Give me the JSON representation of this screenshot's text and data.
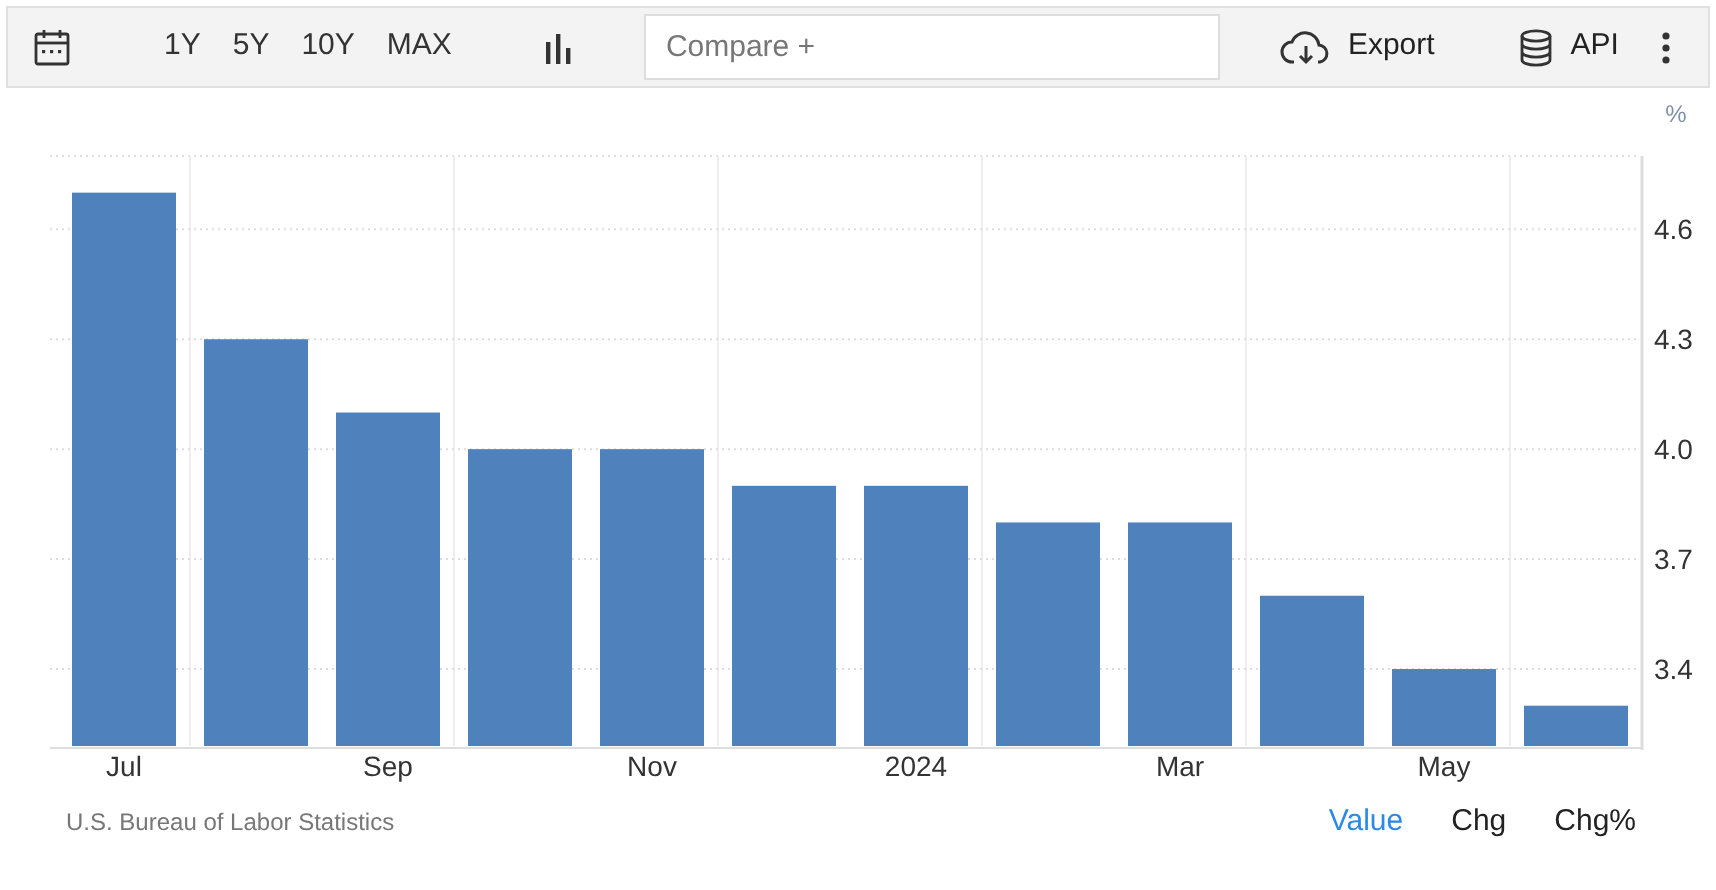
{
  "toolbar": {
    "ranges": [
      {
        "label": "1Y",
        "selected": false
      },
      {
        "label": "5Y",
        "selected": false
      },
      {
        "label": "10Y",
        "selected": false
      },
      {
        "label": "MAX",
        "selected": false
      }
    ],
    "compare": {
      "placeholder": "Compare +"
    },
    "actions": [
      {
        "label": "Export",
        "kind": "export"
      },
      {
        "label": "API",
        "kind": "api"
      }
    ]
  },
  "chart_data": {
    "type": "bar",
    "ylabel": "%",
    "grid": true,
    "categories": [
      "Jul",
      null,
      "Sep",
      null,
      "Nov",
      null,
      "2024",
      null,
      "Mar",
      null,
      "May",
      null
    ],
    "series": [
      {
        "color": "#4f81bd",
        "values": [
          4.7,
          4.3,
          4.1,
          4.0,
          4.0,
          3.9,
          3.9,
          3.8,
          3.8,
          3.6,
          3.4,
          3.3
        ]
      }
    ],
    "ylim": [
      3.19,
      4.8
    ],
    "yticks": [
      {
        "value": 3.4,
        "label": "3.4"
      },
      {
        "value": 3.7,
        "label": "3.7"
      },
      {
        "value": 4.0,
        "label": "4.0"
      },
      {
        "value": 4.3,
        "label": "4.3"
      },
      {
        "value": 4.6,
        "label": "4.6"
      }
    ]
  },
  "source": "U.S. Bureau of Labor Statistics",
  "views": [
    {
      "label": "Value",
      "selected": true
    },
    {
      "label": "Chg",
      "selected": false
    },
    {
      "label": "Chg%",
      "selected": false
    }
  ]
}
